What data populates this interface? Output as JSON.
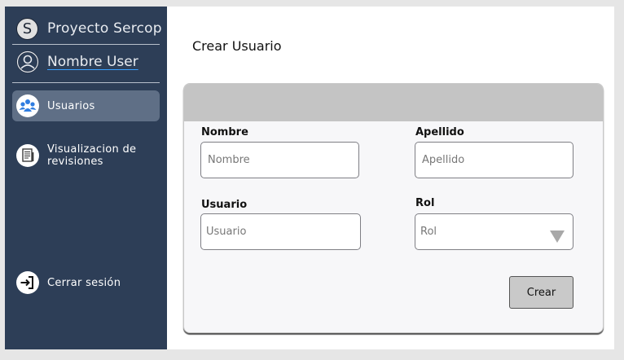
{
  "sidebar": {
    "brand": {
      "initial": "S",
      "name": "Proyecto Sercop"
    },
    "user": {
      "name": "Nombre User"
    },
    "items": [
      {
        "label": "Usuarios",
        "icon": "users-icon"
      },
      {
        "label_line1": "Visualizacion de",
        "label_line2": "revisiones",
        "icon": "document-icon"
      },
      {
        "label": "Cerrar sesión",
        "icon": "logout-icon"
      }
    ]
  },
  "main": {
    "title": "Crear Usuario",
    "form": {
      "nombre": {
        "label": "Nombre",
        "placeholder": "Nombre"
      },
      "apellido": {
        "label": "Apellido",
        "placeholder": "Apellido"
      },
      "usuario": {
        "label": "Usuario",
        "placeholder": "Usuario"
      },
      "rol": {
        "label": "Rol",
        "value": "Rol"
      },
      "submit_label": "Crear"
    }
  },
  "colors": {
    "sidebar_bg": "#2d3e57",
    "active_item_bg": "#5f6f86",
    "card_header": "#c4c4c4",
    "button_bg": "#c9c9c9"
  }
}
